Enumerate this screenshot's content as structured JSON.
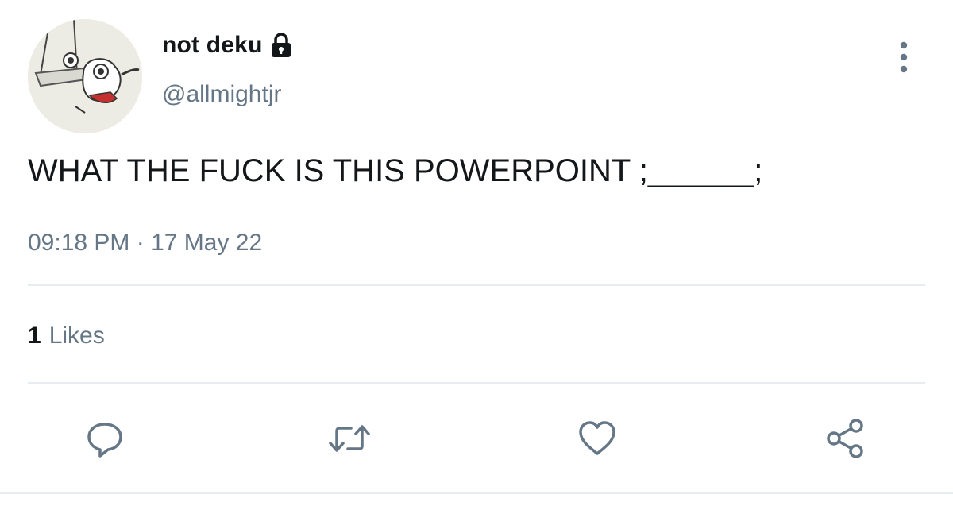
{
  "profile": {
    "display_name": "not deku",
    "handle": "@allmightjr",
    "avatar_icon": "avatar-image",
    "protected_icon": "lock-icon"
  },
  "tweet": {
    "text": "WHAT THE FUCK IS THIS POWERPOINT ;______;",
    "timestamp": "09:18 PM · 17 May 22"
  },
  "stats": {
    "likes_count": "1",
    "likes_label": "Likes"
  },
  "actions": {
    "more": "more-options-icon",
    "reply": "reply-icon",
    "retweet": "retweet-icon",
    "like": "heart-icon",
    "share": "share-icon"
  },
  "colors": {
    "text_primary": "#14171a",
    "text_secondary": "#657786",
    "icon_gray": "#657786",
    "divider": "#e6ecf0"
  }
}
